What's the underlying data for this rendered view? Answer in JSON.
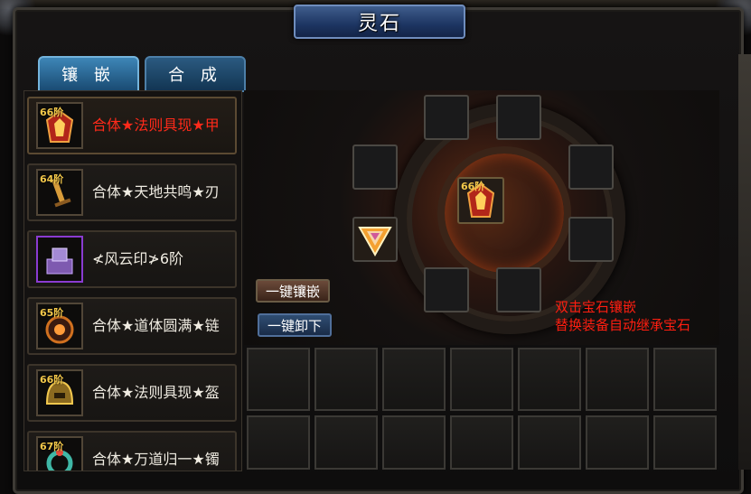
{
  "window": {
    "title": "灵石"
  },
  "tabs": [
    {
      "label": "镶 嵌",
      "active": true
    },
    {
      "label": "合 成",
      "active": false
    }
  ],
  "equipment_list": [
    {
      "tier": "66阶",
      "label": "合体★法则具现★甲",
      "color": "#ff2a1a",
      "icon": "armor-icon",
      "selected": true
    },
    {
      "tier": "64阶",
      "label": "合体★天地共鸣★刃",
      "color": "#f0ece2",
      "icon": "blade-icon"
    },
    {
      "tier": "",
      "label": "≮风云印≯6阶",
      "color": "#f0ece2",
      "icon": "seal-icon"
    },
    {
      "tier": "65阶",
      "label": "合体★道体圆满★链",
      "color": "#f0ece2",
      "icon": "necklace-icon"
    },
    {
      "tier": "66阶",
      "label": "合体★法则具现★盔",
      "color": "#f0ece2",
      "icon": "helmet-icon"
    },
    {
      "tier": "67阶",
      "label": "合体★万道归一★镯",
      "color": "#f0ece2",
      "icon": "bracelet-icon"
    }
  ],
  "center_item": {
    "tier": "66阶",
    "icon": "armor-icon"
  },
  "gem_slots": [
    {
      "filled": false
    },
    {
      "filled": false
    },
    {
      "filled": false
    },
    {
      "filled": false
    },
    {
      "filled": false
    },
    {
      "filled": false
    },
    {
      "filled": false
    },
    {
      "filled": true,
      "icon": "gem-icon"
    }
  ],
  "buttons": {
    "embed_all": "一键镶嵌",
    "remove_all": "一键卸下"
  },
  "hint": {
    "line1": "双击宝石镶嵌",
    "line2": "替换装备自动继承宝石"
  },
  "inventory": {
    "visible_cells": 14
  }
}
